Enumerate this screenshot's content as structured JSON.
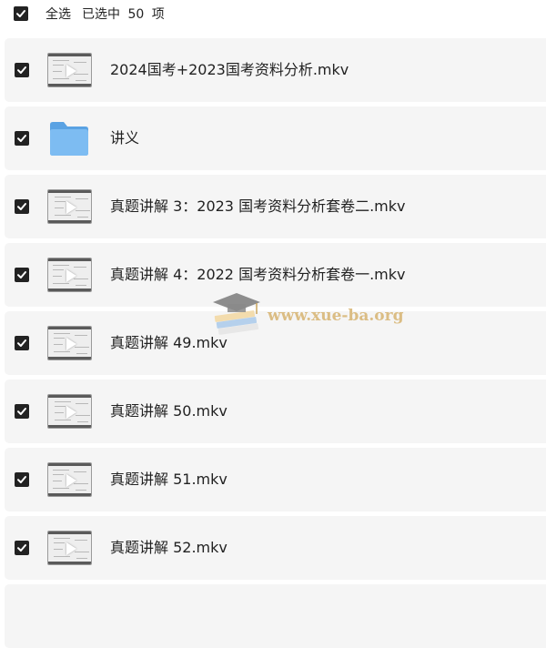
{
  "header": {
    "select_all_label": "全选",
    "selected_count_text": "已选中 50 项",
    "select_all_checked": true
  },
  "items": [
    {
      "name": "2024国考+2023国考资料分析.mkv",
      "type": "video",
      "checked": true
    },
    {
      "name": "讲义",
      "type": "folder",
      "checked": true
    },
    {
      "name": "真题讲解 3：2023 国考资料分析套卷二.mkv",
      "type": "video",
      "checked": true
    },
    {
      "name": "真题讲解 4：2022 国考资料分析套卷一.mkv",
      "type": "video",
      "checked": true
    },
    {
      "name": "真题讲解 49.mkv",
      "type": "video",
      "checked": true
    },
    {
      "name": "真题讲解 50.mkv",
      "type": "video",
      "checked": true
    },
    {
      "name": "真题讲解 51.mkv",
      "type": "video",
      "checked": true
    },
    {
      "name": "真题讲解 52.mkv",
      "type": "video",
      "checked": true
    }
  ],
  "watermark": {
    "text": "www.xue-ba.org",
    "icon": "graduation-cap-books-icon"
  },
  "colors": {
    "checkbox": "#222222",
    "row_background": "#f5f5f5",
    "folder_blue": "#6fb2ea",
    "watermark_gold": "#d9b878"
  }
}
